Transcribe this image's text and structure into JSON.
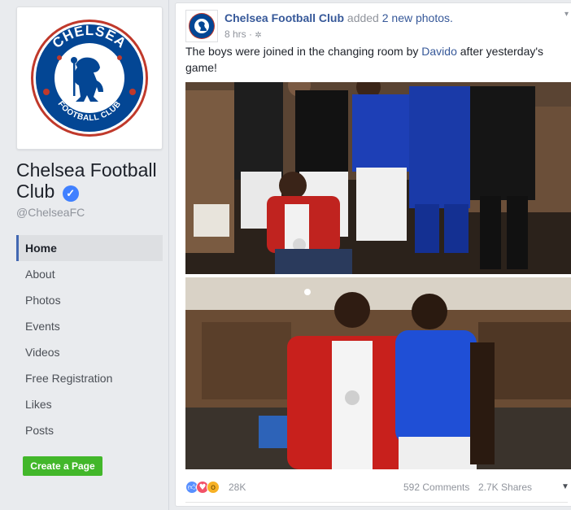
{
  "page": {
    "name": "Chelsea Football Club",
    "handle": "@ChelseaFC",
    "logo_text_top": "CHELSEA",
    "logo_text_bottom": "FOOTBALL CLUB",
    "verified_icon": "check-icon"
  },
  "sidebar": {
    "items": [
      {
        "label": "Home"
      },
      {
        "label": "About"
      },
      {
        "label": "Photos"
      },
      {
        "label": "Events"
      },
      {
        "label": "Videos"
      },
      {
        "label": "Free Registration"
      },
      {
        "label": "Likes"
      },
      {
        "label": "Posts"
      }
    ],
    "active_index": 0,
    "create_page_label": "Create a Page"
  },
  "post": {
    "author": "Chelsea Football Club",
    "action": "added",
    "action_link": "2 new photos.",
    "time": "8 hrs",
    "separator": "·",
    "privacy_icon": "globe-icon",
    "text_before": "The boys were joined in the changing room by ",
    "mention": "Davido",
    "text_after": " after yesterday's game!",
    "reactions_count": "28K",
    "comments": "592 Comments",
    "shares": "2.7K Shares"
  },
  "colors": {
    "link": "#365899",
    "accent": "#4267b2",
    "green_button": "#42b72a",
    "chelsea_blue": "#034694"
  }
}
